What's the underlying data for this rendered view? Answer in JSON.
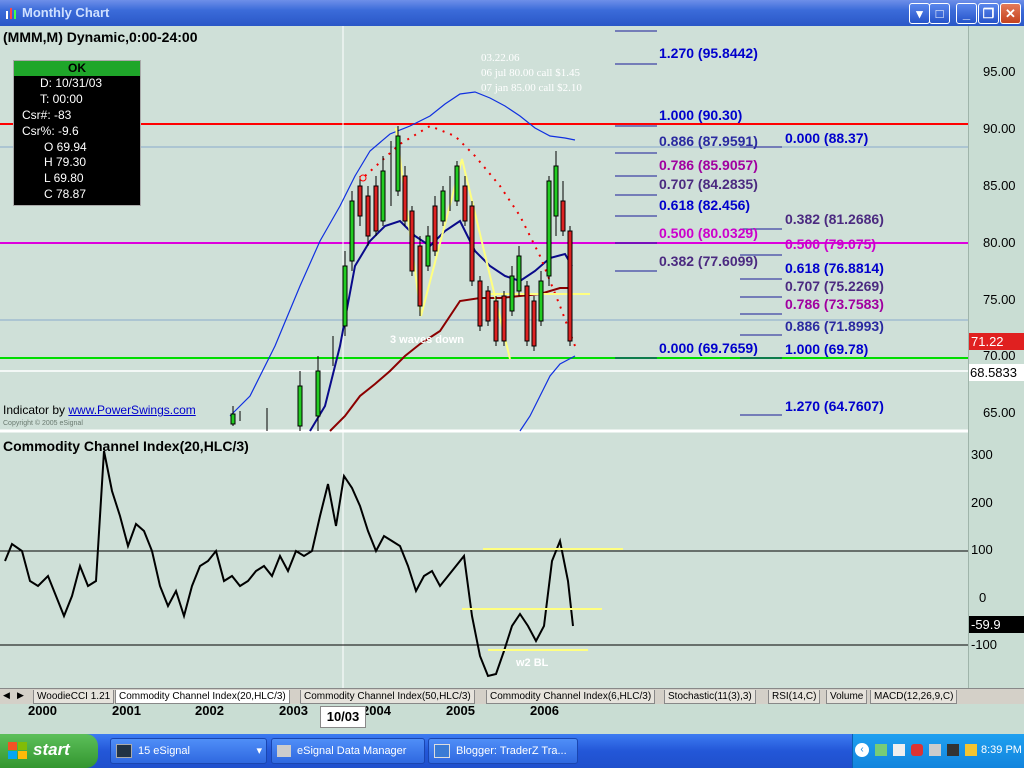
{
  "window": {
    "title": "Monthly Chart"
  },
  "chart": {
    "symbol_label": "(MMM,M) Dynamic,0:00-24:00",
    "indicator_credit_prefix": "Indicator by ",
    "indicator_credit_link": "www.PowerSwings.com",
    "copyright": "Copyright © 2005 eSignal",
    "annotation_date": "03.22.06",
    "annotation_line1": "06 jul 80.00 call $1.45",
    "annotation_line2": "07 jan 85.00 call $2.10",
    "waves_label": "3 waves down",
    "cci_title": "Commodity Channel Index(20,HLC/3)",
    "cci_annotation": "w2 BL",
    "cursor_date_label": "10/03",
    "last_price": "71.22",
    "cursor_price": "68.5833",
    "cci_last": "-59.9",
    "price_axis": [
      "95.00",
      "90.00",
      "85.00",
      "80.00",
      "75.00",
      "70.00",
      "65.00"
    ],
    "cci_axis": [
      "300",
      "200",
      "100",
      "0",
      "-100"
    ],
    "x_axis": [
      "2000",
      "2001",
      "2002",
      "2003",
      "2004",
      "2005",
      "2006"
    ]
  },
  "ok_panel": {
    "header": "OK",
    "rows": [
      "D: 10/31/03",
      "T: 00:00",
      "Csr#: -83",
      "Csr%: -9.6",
      "O 69.94",
      "H 79.30",
      "L 69.80",
      "C 78.87"
    ]
  },
  "fib_left": [
    {
      "text": "1.270 (95.8442)",
      "color": "#0000cc"
    },
    {
      "text": "1.000 (90.30)",
      "color": "#0000cc"
    },
    {
      "text": "0.886 (87.9591)",
      "color": "#2a2aa0"
    },
    {
      "text": "0.786 (85.9057)",
      "color": "#a000a0"
    },
    {
      "text": "0.707 (84.2835)",
      "color": "#4b2a80"
    },
    {
      "text": "0.618 (82.456)",
      "color": "#0000cc"
    },
    {
      "text": "0.500 (80.0329)",
      "color": "#cc00cc"
    },
    {
      "text": "0.382 (77.6099)",
      "color": "#4b2a80"
    },
    {
      "text": "0.000 (69.7659)",
      "color": "#0000cc"
    }
  ],
  "fib_right": [
    {
      "text": "0.000 (88.37)",
      "color": "#0000cc"
    },
    {
      "text": "0.382 (81.2686)",
      "color": "#4b2a80"
    },
    {
      "text": "0.500 (79.075)",
      "color": "#cc00cc"
    },
    {
      "text": "0.618 (76.8814)",
      "color": "#0000cc"
    },
    {
      "text": "0.707 (75.2269)",
      "color": "#4b2a80"
    },
    {
      "text": "0.786 (73.7583)",
      "color": "#a000a0"
    },
    {
      "text": "0.886 (71.8993)",
      "color": "#2a2aa0"
    },
    {
      "text": "1.000 (69.78)",
      "color": "#0000cc"
    },
    {
      "text": "1.270 (64.7607)",
      "color": "#0000cc"
    }
  ],
  "tabs": [
    "WoodieCCI 1.21",
    "Commodity Channel Index(20,HLC/3)",
    "Commodity Channel Index(50,HLC/3)",
    "Commodity Channel Index(6,HLC/3)",
    "Stochastic(11(3),3)",
    "RSI(14,C)",
    "Volume",
    "MACD(12,26,9,C)"
  ],
  "taskbar": {
    "start": "start",
    "tasks": [
      "15 eSignal",
      "eSignal Data Manager",
      "Blogger: TraderZ Tra..."
    ],
    "clock": "8:39 PM"
  },
  "colors": {
    "titlebar": "#2a57c7",
    "chart_bg": "#cfe0d8",
    "up_candle": "#22cc22",
    "down_candle": "#dd2222"
  }
}
